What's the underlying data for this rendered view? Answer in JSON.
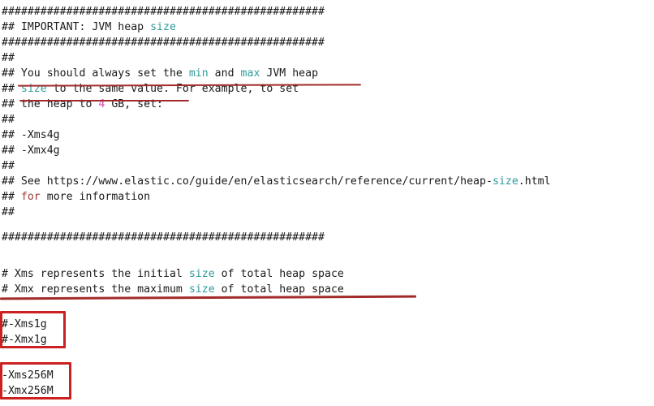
{
  "document": {
    "kind": "jvm-options-config-file",
    "font_size_px": 13.2,
    "line_height_px": 19,
    "background_color": "#ffffff",
    "default_text_color": "#1a1a1a",
    "syntax_colors": {
      "type": "#2e9b9b",
      "keyword": "#9c3b36",
      "number": "#d14ab5",
      "plain": "#1a1a1a"
    },
    "annotation_colors": {
      "underline": "#a32a2a",
      "box": "#cc2121"
    }
  },
  "lines": {
    "l1": "##################################################",
    "l2a": "## IMPORTANT: JVM heap ",
    "l2b": "size",
    "l3": "##################################################",
    "l4": "##",
    "l5a": "## You should always set the ",
    "l5b": "min",
    "l5c": " and ",
    "l5d": "max",
    "l5e": " JVM heap",
    "l6a": "## ",
    "l6b": "size",
    "l6c": " to the same value. For example, to set",
    "l7a": "## the heap to ",
    "l7b": "4",
    "l7c": " GB, set:",
    "l8": "##",
    "l9": "## -Xms4g",
    "l10": "## -Xmx4g",
    "l11": "##",
    "l12a": "## See https://www.elastic.co/guide/en/elasticsearch/reference/current/heap-",
    "l12b": "size",
    "l12c": ".html",
    "l13a": "## ",
    "l13b": "for",
    "l13c": " more information",
    "l14": "##",
    "l15": "##################################################",
    "l16a": "# Xms represents the initial ",
    "l16b": "size",
    "l16c": " of total heap space",
    "l17a": "# Xmx represents the maximum ",
    "l17b": "size",
    "l17c": " of total heap space",
    "l18": "#-Xms1g",
    "l19": "#-Xmx1g",
    "l20": "-Xms256M",
    "l21": "-Xmx256M"
  },
  "annotations": {
    "underline_1_label": "underline under 'You should always set the min and max JVM heap'",
    "underline_2_label": "underline under 'size to the same value.'",
    "underline_3_label": "underline under '# Xmx represents the maximum size of total heap space'",
    "box_1_label": "highlighted commented-out heap settings #-Xms1g / #-Xmx1g",
    "box_2_label": "highlighted active heap settings -Xms256M / -Xmx256M"
  }
}
